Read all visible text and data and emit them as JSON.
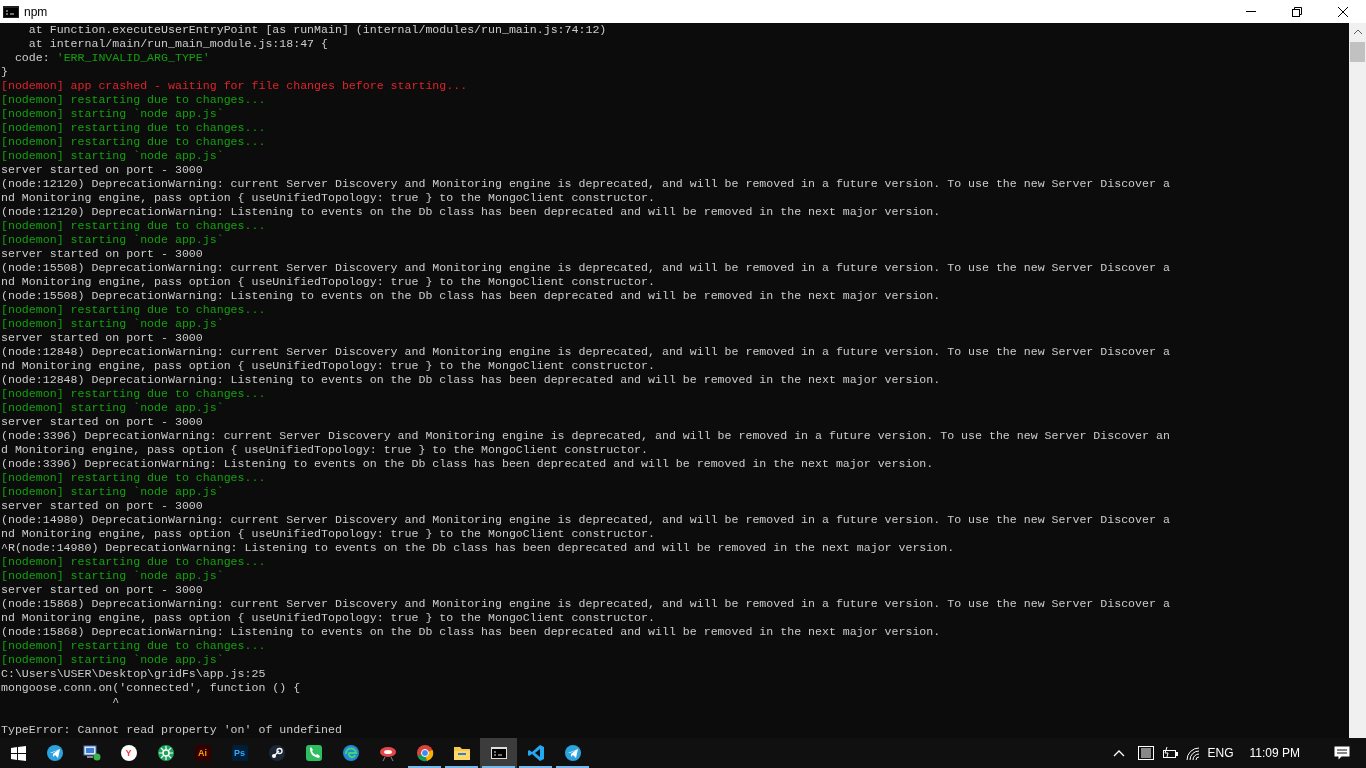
{
  "window": {
    "title": "npm"
  },
  "terminal": {
    "lines": [
      {
        "kind": "plain",
        "text": "    at Function.executeUserEntryPoint [as runMain] (internal/modules/run_main.js:74:12)"
      },
      {
        "kind": "plain",
        "text": "    at internal/main/run_main_module.js:18:47 {"
      },
      {
        "kind": "mixed",
        "parts": [
          {
            "kind": "plain",
            "text": "  code: "
          },
          {
            "kind": "string",
            "text": "'ERR_INVALID_ARG_TYPE'"
          }
        ]
      },
      {
        "kind": "plain",
        "text": "}"
      },
      {
        "kind": "error",
        "text": "[nodemon] app crashed - waiting for file changes before starting..."
      },
      {
        "kind": "nodemon",
        "text": "[nodemon] restarting due to changes..."
      },
      {
        "kind": "nodemon",
        "text": "[nodemon] starting `node app.js`"
      },
      {
        "kind": "nodemon",
        "text": "[nodemon] restarting due to changes..."
      },
      {
        "kind": "nodemon",
        "text": "[nodemon] restarting due to changes..."
      },
      {
        "kind": "nodemon",
        "text": "[nodemon] starting `node app.js`"
      },
      {
        "kind": "plain",
        "text": "server started on port - 3000"
      },
      {
        "kind": "plain",
        "text": "(node:12120) DeprecationWarning: current Server Discovery and Monitoring engine is deprecated, and will be removed in a future version. To use the new Server Discover a"
      },
      {
        "kind": "plain",
        "text": "nd Monitoring engine, pass option { useUnifiedTopology: true } to the MongoClient constructor."
      },
      {
        "kind": "plain",
        "text": "(node:12120) DeprecationWarning: Listening to events on the Db class has been deprecated and will be removed in the next major version."
      },
      {
        "kind": "nodemon",
        "text": "[nodemon] restarting due to changes..."
      },
      {
        "kind": "nodemon",
        "text": "[nodemon] starting `node app.js`"
      },
      {
        "kind": "plain",
        "text": "server started on port - 3000"
      },
      {
        "kind": "plain",
        "text": "(node:15508) DeprecationWarning: current Server Discovery and Monitoring engine is deprecated, and will be removed in a future version. To use the new Server Discover a"
      },
      {
        "kind": "plain",
        "text": "nd Monitoring engine, pass option { useUnifiedTopology: true } to the MongoClient constructor."
      },
      {
        "kind": "plain",
        "text": "(node:15508) DeprecationWarning: Listening to events on the Db class has been deprecated and will be removed in the next major version."
      },
      {
        "kind": "nodemon",
        "text": "[nodemon] restarting due to changes..."
      },
      {
        "kind": "nodemon",
        "text": "[nodemon] starting `node app.js`"
      },
      {
        "kind": "plain",
        "text": "server started on port - 3000"
      },
      {
        "kind": "plain",
        "text": "(node:12848) DeprecationWarning: current Server Discovery and Monitoring engine is deprecated, and will be removed in a future version. To use the new Server Discover a"
      },
      {
        "kind": "plain",
        "text": "nd Monitoring engine, pass option { useUnifiedTopology: true } to the MongoClient constructor."
      },
      {
        "kind": "plain",
        "text": "(node:12848) DeprecationWarning: Listening to events on the Db class has been deprecated and will be removed in the next major version."
      },
      {
        "kind": "nodemon",
        "text": "[nodemon] restarting due to changes..."
      },
      {
        "kind": "nodemon",
        "text": "[nodemon] starting `node app.js`"
      },
      {
        "kind": "plain",
        "text": "server started on port - 3000"
      },
      {
        "kind": "plain",
        "text": "(node:3396) DeprecationWarning: current Server Discovery and Monitoring engine is deprecated, and will be removed in a future version. To use the new Server Discover an"
      },
      {
        "kind": "plain",
        "text": "d Monitoring engine, pass option { useUnifiedTopology: true } to the MongoClient constructor."
      },
      {
        "kind": "plain",
        "text": "(node:3396) DeprecationWarning: Listening to events on the Db class has been deprecated and will be removed in the next major version."
      },
      {
        "kind": "nodemon",
        "text": "[nodemon] restarting due to changes..."
      },
      {
        "kind": "nodemon",
        "text": "[nodemon] starting `node app.js`"
      },
      {
        "kind": "plain",
        "text": "server started on port - 3000"
      },
      {
        "kind": "plain",
        "text": "(node:14980) DeprecationWarning: current Server Discovery and Monitoring engine is deprecated, and will be removed in a future version. To use the new Server Discover a"
      },
      {
        "kind": "plain",
        "text": "nd Monitoring engine, pass option { useUnifiedTopology: true } to the MongoClient constructor."
      },
      {
        "kind": "plain",
        "text": "^R(node:14980) DeprecationWarning: Listening to events on the Db class has been deprecated and will be removed in the next major version."
      },
      {
        "kind": "nodemon",
        "text": "[nodemon] restarting due to changes..."
      },
      {
        "kind": "nodemon",
        "text": "[nodemon] starting `node app.js`"
      },
      {
        "kind": "plain",
        "text": "server started on port - 3000"
      },
      {
        "kind": "plain",
        "text": "(node:15868) DeprecationWarning: current Server Discovery and Monitoring engine is deprecated, and will be removed in a future version. To use the new Server Discover a"
      },
      {
        "kind": "plain",
        "text": "nd Monitoring engine, pass option { useUnifiedTopology: true } to the MongoClient constructor."
      },
      {
        "kind": "plain",
        "text": "(node:15868) DeprecationWarning: Listening to events on the Db class has been deprecated and will be removed in the next major version."
      },
      {
        "kind": "nodemon",
        "text": "[nodemon] restarting due to changes..."
      },
      {
        "kind": "nodemon",
        "text": "[nodemon] starting `node app.js`"
      },
      {
        "kind": "plain",
        "text": "C:\\Users\\USER\\Desktop\\gridFs\\app.js:25"
      },
      {
        "kind": "plain",
        "text": "mongoose.conn.on('connected', function () {"
      },
      {
        "kind": "plain",
        "text": "                ^"
      },
      {
        "kind": "plain",
        "text": "TypeError: Cannot read property 'on' of undefined"
      }
    ]
  },
  "taskbar": {
    "apps": [
      {
        "kind": "telegram",
        "running": false,
        "selected": false
      },
      {
        "kind": "computer",
        "running": false,
        "selected": false
      },
      {
        "kind": "yandex",
        "label": "Y",
        "running": false,
        "selected": false
      },
      {
        "kind": "flower",
        "running": false,
        "selected": false
      },
      {
        "kind": "illustrator",
        "label": "Ai",
        "running": false,
        "selected": false
      },
      {
        "kind": "photoshop",
        "label": "Ps",
        "running": false,
        "selected": false
      },
      {
        "kind": "steam",
        "running": false,
        "selected": false
      },
      {
        "kind": "phone",
        "running": false,
        "selected": false
      },
      {
        "kind": "edge",
        "running": false,
        "selected": false
      },
      {
        "kind": "bird",
        "running": false,
        "selected": false
      },
      {
        "kind": "chrome",
        "running": true,
        "selected": false
      },
      {
        "kind": "folder",
        "running": true,
        "selected": false
      },
      {
        "kind": "console",
        "running": true,
        "selected": true
      },
      {
        "kind": "vscode",
        "running": true,
        "selected": false
      },
      {
        "kind": "telegram",
        "running": true,
        "selected": false
      }
    ],
    "language": "ENG",
    "time": "11:09 PM"
  }
}
